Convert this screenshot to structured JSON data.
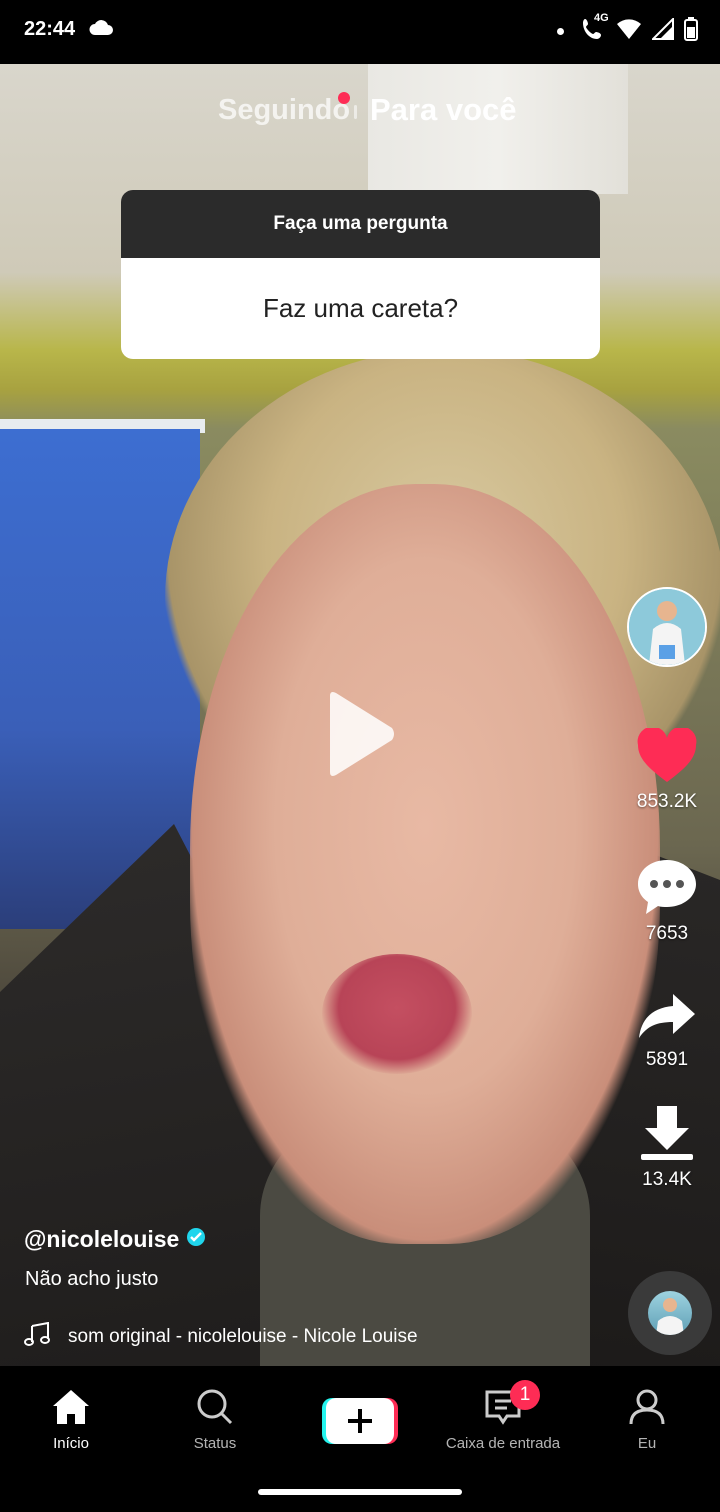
{
  "status_bar": {
    "time": "22:44",
    "network": "4G",
    "icons": [
      "cloud-icon",
      "dot-icon",
      "wifi-calling-icon",
      "wifi-icon",
      "signal-icon",
      "battery-icon"
    ]
  },
  "feed_tabs": {
    "following": "Seguindo",
    "for_you": "Para você",
    "active": "for_you",
    "accent": "#fe2c55"
  },
  "question_sticker": {
    "header": "Faça uma pergunta",
    "question": "Faz uma careta?"
  },
  "video": {
    "state": "paused",
    "play_icon": "play-icon"
  },
  "actions": {
    "likes": "853.2K",
    "comments": "7653",
    "shares": "5891",
    "saves": "13.4K",
    "like_color": "#fe2c55"
  },
  "post": {
    "username": "@nicolelouise",
    "verified": true,
    "caption": "Não acho justo",
    "sound": "som original - nicolelouise - Nicole Louise"
  },
  "bottom_nav": {
    "items": [
      {
        "label": "Início",
        "icon": "home-icon",
        "active": true
      },
      {
        "label": "Status",
        "icon": "search-icon",
        "active": false
      },
      {
        "label": "",
        "icon": "plus-icon",
        "active": false
      },
      {
        "label": "Caixa de entrada",
        "icon": "inbox-icon",
        "active": false,
        "badge": "1"
      },
      {
        "label": "Eu",
        "icon": "profile-icon",
        "active": false
      }
    ]
  }
}
